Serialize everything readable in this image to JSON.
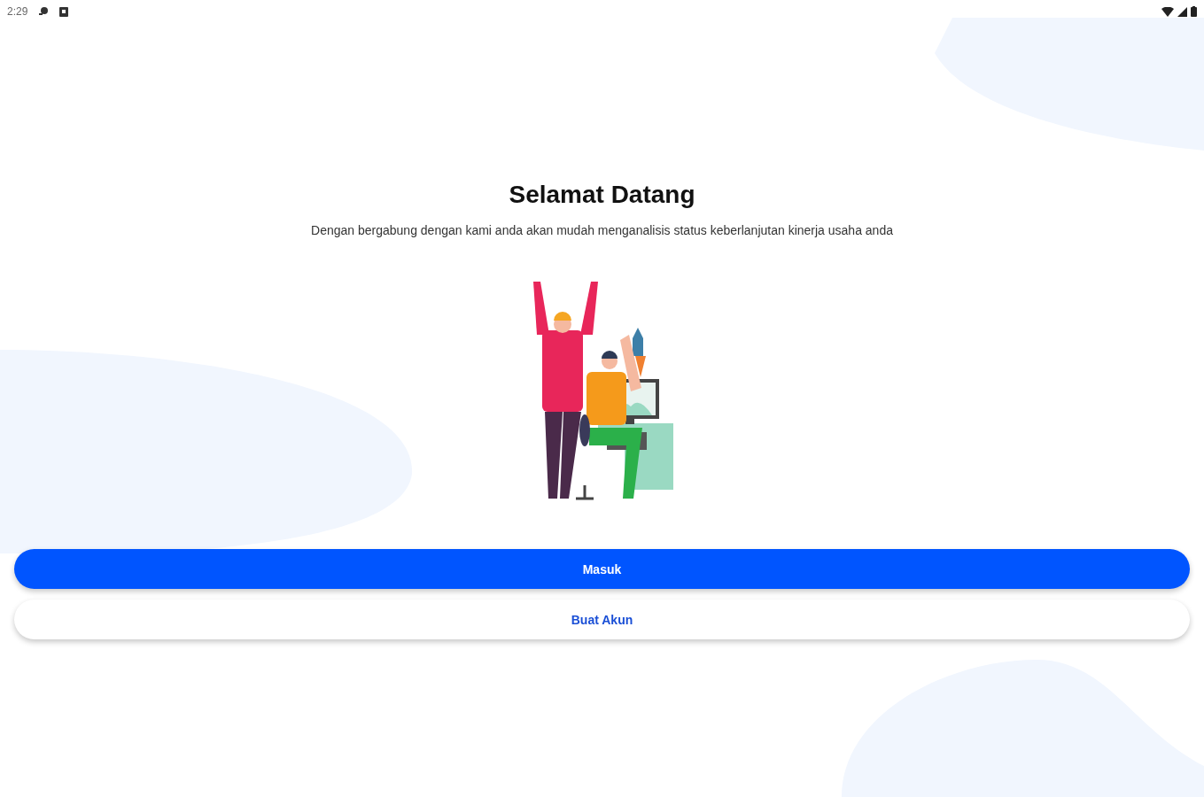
{
  "status_bar": {
    "time": "2:29"
  },
  "title": "Selamat Datang",
  "subtitle": "Dengan bergabung dengan kami anda akan mudah menganalisis status keberlanjutan kinerja usaha anda",
  "buttons": [
    {
      "label": "Masuk",
      "kind": "primary"
    },
    {
      "label": "Buat Akun",
      "kind": "secondary"
    }
  ]
}
